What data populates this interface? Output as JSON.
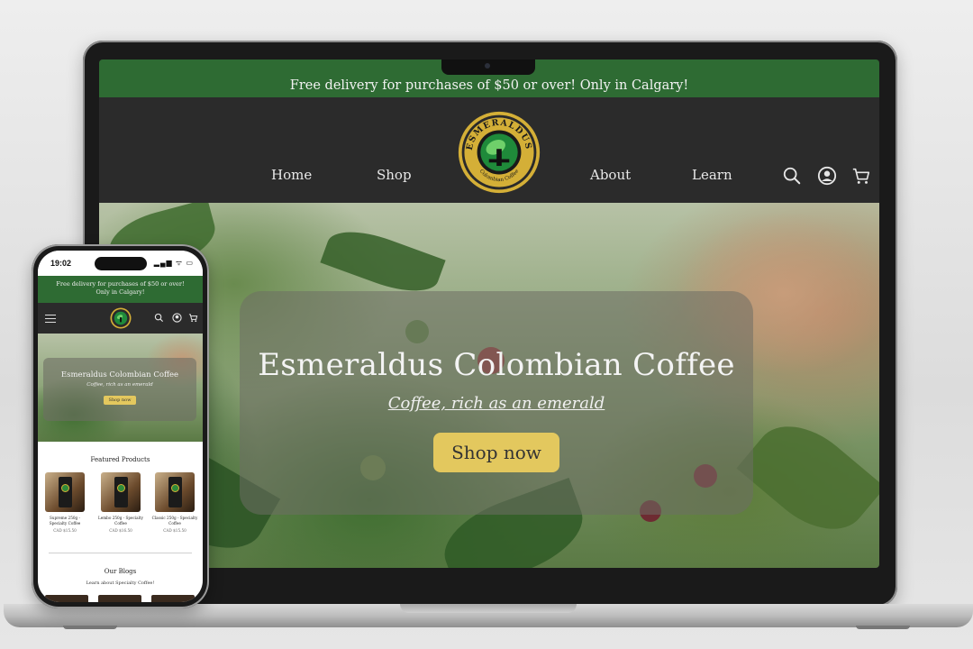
{
  "site": {
    "promo_text": "Free delivery for purchases of $50 or over! Only in Calgary!",
    "nav": {
      "home": "Home",
      "shop": "Shop",
      "about": "About",
      "learn": "Learn"
    },
    "logo": {
      "top_text": "ESMERALDUS",
      "bottom_text": "Colombian Coffee"
    },
    "icons": [
      "search-icon",
      "account-icon",
      "cart-icon"
    ],
    "hero": {
      "title": "Esmeraldus Colombian Coffee",
      "subtitle": "Coffee, rich as an emerald",
      "cta": "Shop now"
    }
  },
  "phone": {
    "status": {
      "time": "19:02",
      "icons": "▂▄▆ ᯤ ▭"
    },
    "promo_text": "Free delivery for purchases of $50 or over! Only in Calgary!",
    "hero": {
      "title": "Esmeraldus Colombian Coffee",
      "subtitle": "Coffee, rich as an emerald",
      "cta": "Shop now"
    },
    "featured_title": "Featured Products",
    "products": [
      {
        "name": "Supreme 250g - Specialty Coffee",
        "price": "CAD $15.50"
      },
      {
        "name": "Lembo 250g - Specialty Coffee",
        "price": "CAD $16.50"
      },
      {
        "name": "Classic 250g - Specialty Coffee",
        "price": "CAD $15.50"
      }
    ],
    "blogs_title": "Our Blogs",
    "blogs_subtitle": "Learn about Specialty Coffee!"
  },
  "colors": {
    "brand_green": "#2e6b33",
    "header_dark": "#2b2b2b",
    "cta_gold": "#e3c85e",
    "logo_gold": "#d4af37",
    "logo_emerald": "#1f8a3a"
  }
}
